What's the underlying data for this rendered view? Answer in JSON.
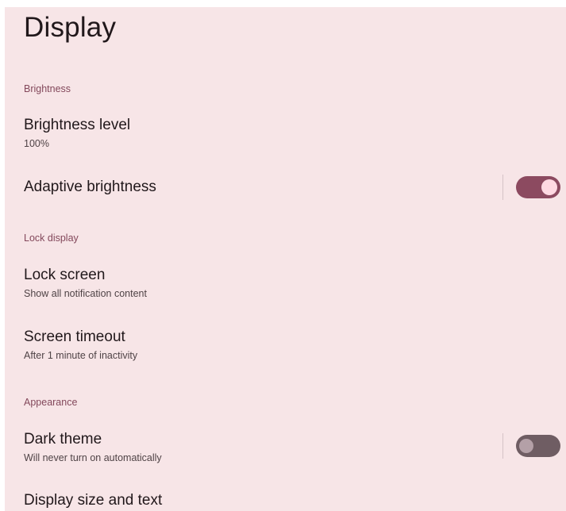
{
  "page": {
    "title": "Display"
  },
  "sections": {
    "brightness": {
      "header": "Brightness",
      "brightness_level": {
        "title": "Brightness level",
        "summary": "100%"
      },
      "adaptive_brightness": {
        "title": "Adaptive brightness",
        "enabled": true
      }
    },
    "lock_display": {
      "header": "Lock display",
      "lock_screen": {
        "title": "Lock screen",
        "summary": "Show all notification content"
      },
      "screen_timeout": {
        "title": "Screen timeout",
        "summary": "After 1 minute of inactivity"
      }
    },
    "appearance": {
      "header": "Appearance",
      "dark_theme": {
        "title": "Dark theme",
        "summary": "Will never turn on automatically",
        "enabled": false
      },
      "display_size": {
        "title": "Display size and text"
      }
    }
  },
  "colors": {
    "background": "#f7e5e7",
    "accent": "#83485b",
    "switch_on_track": "#8c4a60",
    "switch_on_thumb": "#ffd9e2",
    "switch_off_track": "#6f5d63",
    "switch_off_thumb": "#b4a0a7"
  }
}
